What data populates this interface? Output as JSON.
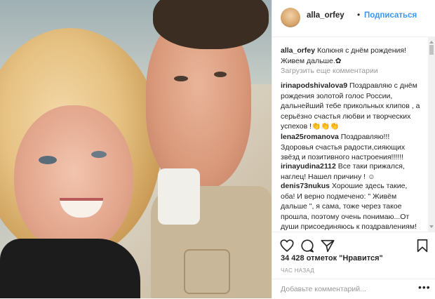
{
  "header": {
    "username": "alla_orfey",
    "separator": "•",
    "follow_label": "Подписаться"
  },
  "caption": {
    "username": "alla_orfey",
    "text": "Колюня с днём рождения! Живем дальше.✿"
  },
  "load_more_label": "Загрузить еще комментарии",
  "comments": [
    {
      "username": "irinapodshivalova9",
      "text": "Поздравляю с днём рождения золотой голос России, дальнейший тебе прикольных клипов , а серьёзно счастья любви и творческих успехов !👏👏👏"
    },
    {
      "username": "lena25romanova",
      "text": "Поздравляю!!! Здоровья счастья радости,сияющих звёзд и позитивного настроения!!!!!!"
    },
    {
      "username": "irinayudina2112",
      "text": "Все таки прижался, наглец! Нашел причину ! ☺"
    },
    {
      "username": "denis73nukus",
      "text": "Хорошие здесь такие, оба! И верно подмечено: \" Живём дальше \", я сама, тоже через такое прошла, поэтому очень понимаю...От души присоединяюсь к поздравлениям! Желаю Николаю Здоровья на долгие"
    }
  ],
  "likes": {
    "count": "34 428",
    "text": "отметок \"Нравится\""
  },
  "timestamp": "ЧАС НАЗАД",
  "add_comment": {
    "placeholder": "Добавьте комментарий..."
  },
  "more_label": "•••",
  "icons": {
    "like": "heart-icon",
    "comment": "comment-icon",
    "share": "share-icon",
    "save": "bookmark-icon"
  }
}
